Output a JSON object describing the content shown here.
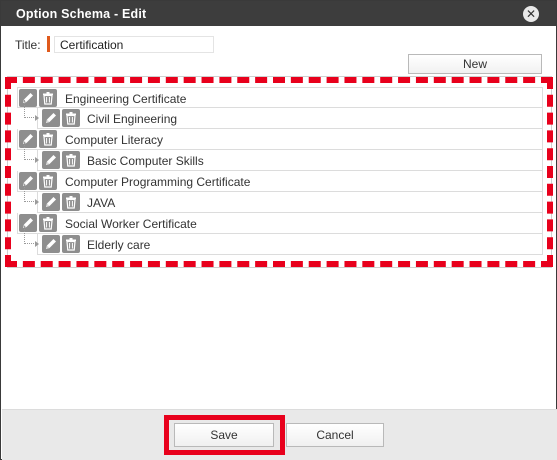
{
  "dialog": {
    "title": "Option Schema - Edit",
    "close_symbol": "✕"
  },
  "form": {
    "title_label": "Title:",
    "title_value": "Certification",
    "new_label": "New"
  },
  "tree": {
    "items": [
      {
        "label": "Engineering Certificate",
        "level": "parent"
      },
      {
        "label": "Civil Engineering",
        "level": "child"
      },
      {
        "label": "Computer Literacy",
        "level": "parent"
      },
      {
        "label": "Basic Computer Skills",
        "level": "child"
      },
      {
        "label": "Computer Programming Certificate",
        "level": "parent"
      },
      {
        "label": "JAVA",
        "level": "child"
      },
      {
        "label": "Social Worker Certificate",
        "level": "parent"
      },
      {
        "label": "Elderly care",
        "level": "child"
      }
    ],
    "icons": {
      "edit": "pencil-icon",
      "delete": "trash-icon"
    }
  },
  "footer": {
    "save_label": "Save",
    "cancel_label": "Cancel"
  },
  "colors": {
    "titlebar": "#3d3d3d",
    "highlight": "#e8001c",
    "title_marker": "#e05a1c",
    "icon_bg": "#8e8e8e"
  }
}
